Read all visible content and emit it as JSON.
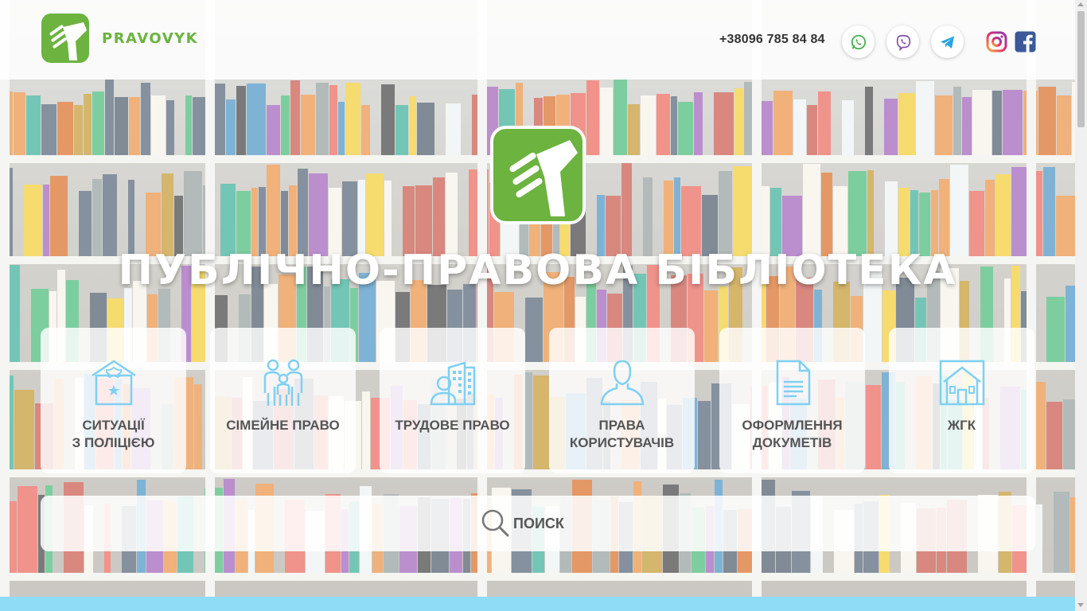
{
  "header": {
    "brand": "PRAVOVYK",
    "phone": "+38096 785 84 84",
    "messengers": [
      {
        "icon": "whatsapp-icon",
        "color": "#4caf50"
      },
      {
        "icon": "viber-icon",
        "color": "#7d4fa3"
      },
      {
        "icon": "telegram-icon",
        "color": "#2aa3de"
      }
    ],
    "socials": [
      {
        "icon": "instagram-icon"
      },
      {
        "icon": "facebook-icon",
        "color": "#3b5998"
      }
    ]
  },
  "hero": {
    "title": "ПУБЛІЧНО-ПРАВОВА БІБЛІОТЕКА"
  },
  "categories": [
    {
      "label": "СИТУАЦІЇ\nЗ ПОЛІЦІЄЮ",
      "icon": "police-badge-icon"
    },
    {
      "label": "СІМЕЙНЕ ПРАВО",
      "icon": "family-icon"
    },
    {
      "label": "ТРУДОВЕ ПРАВО",
      "icon": "office-worker-icon"
    },
    {
      "label": "ПРАВА\nКОРИСТУВАЧІВ",
      "icon": "user-icon"
    },
    {
      "label": "ОФОРМЛЕННЯ\nДОКУМЕТІВ",
      "icon": "document-icon"
    },
    {
      "label": "ЖГК",
      "icon": "house-icon"
    }
  ],
  "search": {
    "label": "ПОИСК",
    "icon": "search-icon"
  },
  "colors": {
    "brand_green": "#6cb33f",
    "icon_blue": "#7fd0f2",
    "strip_blue": "#8fdcf7"
  }
}
